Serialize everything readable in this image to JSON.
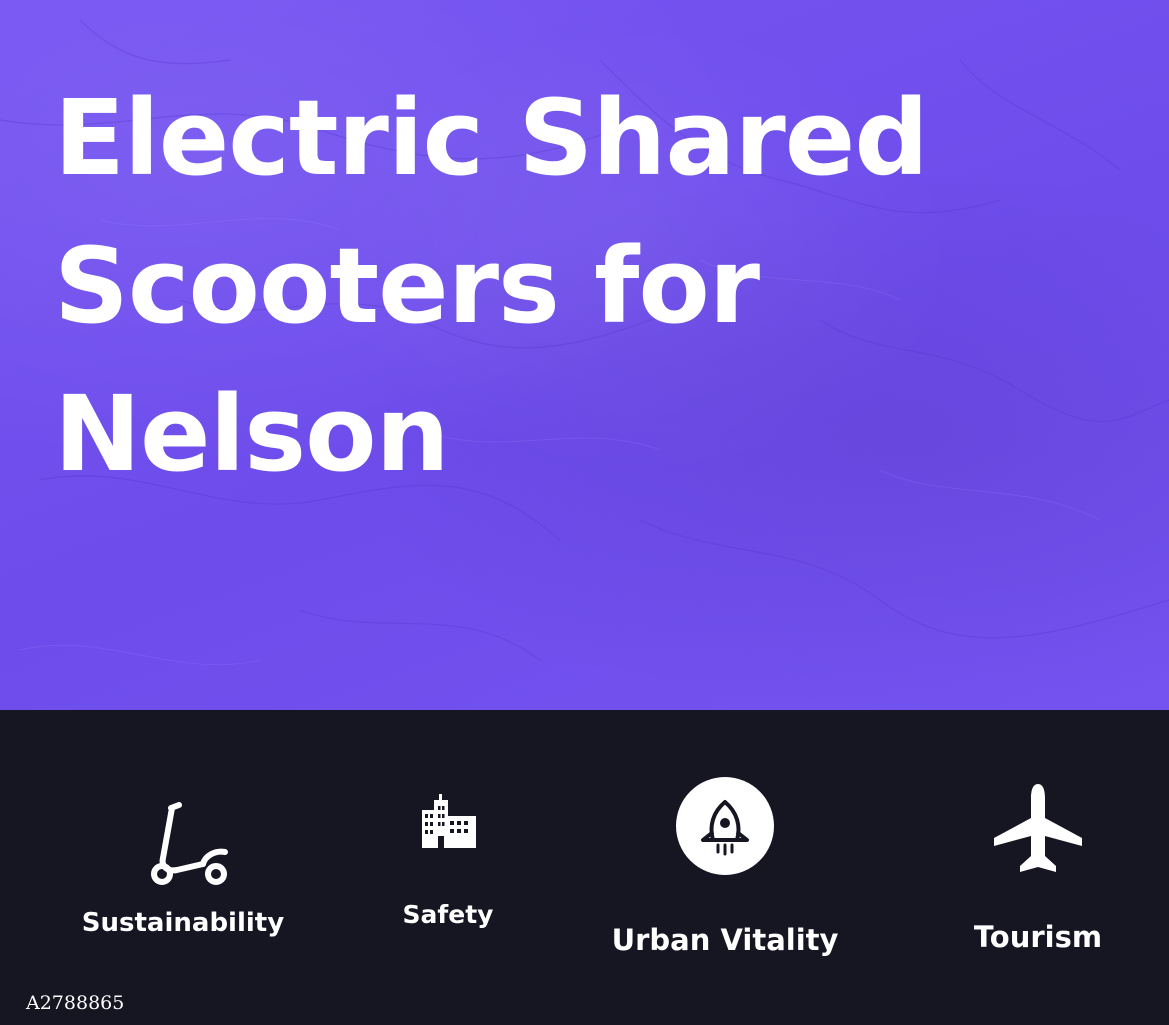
{
  "colors": {
    "hero_background": "#7251ee",
    "footer_background": "#161522",
    "text": "#ffffff"
  },
  "hero": {
    "title_lines": [
      "Electric Shared",
      "Scooters for",
      "Nelson"
    ]
  },
  "features": [
    {
      "label": "Sustainability",
      "icon": "scooter-icon"
    },
    {
      "label": "Safety",
      "icon": "building-icon"
    },
    {
      "label": "Urban Vitality",
      "icon": "rocket-icon"
    },
    {
      "label": "Tourism",
      "icon": "airplane-icon"
    }
  ],
  "footer_code": "A2788865"
}
